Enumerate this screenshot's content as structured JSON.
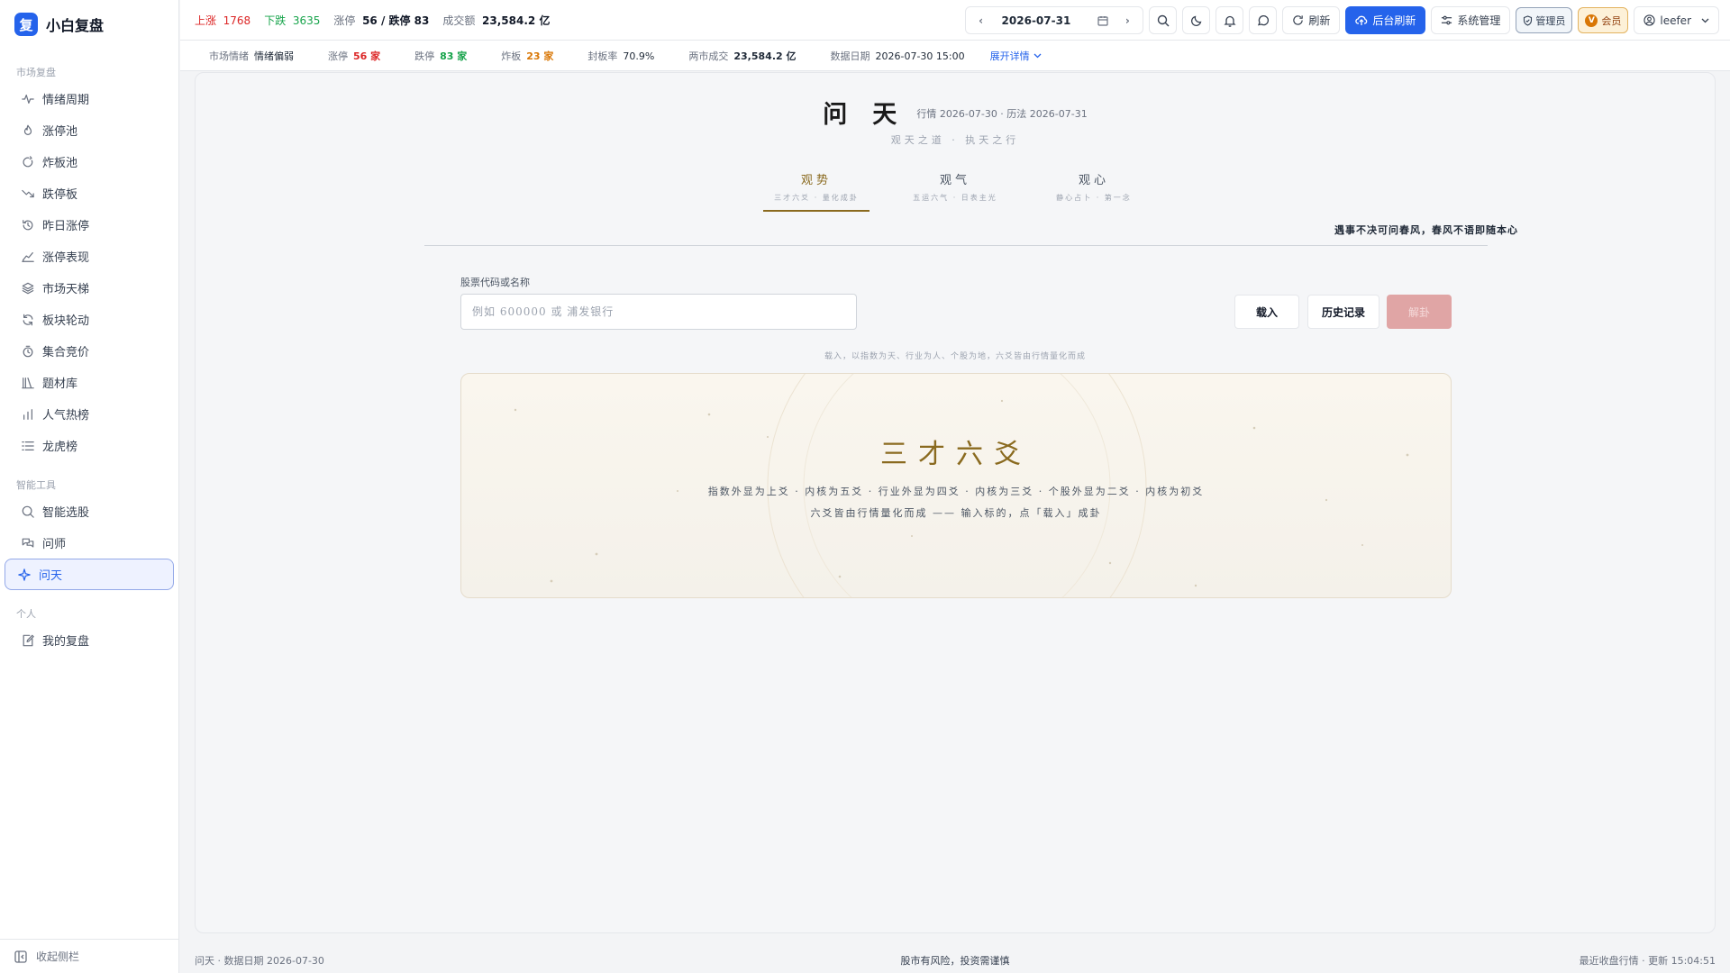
{
  "brand": {
    "logo": "复",
    "name": "小白复盘"
  },
  "sidebar": {
    "groups": [
      {
        "label": "市场复盘",
        "items": [
          {
            "label": "情绪周期",
            "icon": "activity-icon"
          },
          {
            "label": "涨停池",
            "icon": "flame-icon"
          },
          {
            "label": "炸板池",
            "icon": "burst-icon"
          },
          {
            "label": "跌停板",
            "icon": "trend-down-icon"
          },
          {
            "label": "昨日涨停",
            "icon": "history-icon"
          },
          {
            "label": "涨停表现",
            "icon": "area-chart-icon"
          },
          {
            "label": "市场天梯",
            "icon": "layers-icon"
          },
          {
            "label": "板块轮动",
            "icon": "rotate-icon"
          },
          {
            "label": "集合竞价",
            "icon": "timer-icon"
          },
          {
            "label": "题材库",
            "icon": "library-icon"
          },
          {
            "label": "人气热榜",
            "icon": "bar-chart-icon"
          },
          {
            "label": "龙虎榜",
            "icon": "list-icon"
          }
        ]
      },
      {
        "label": "智能工具",
        "items": [
          {
            "label": "智能选股",
            "icon": "search-icon"
          },
          {
            "label": "问师",
            "icon": "chat-icon"
          },
          {
            "label": "问天",
            "icon": "sparkle-icon",
            "active": true
          }
        ]
      },
      {
        "label": "个人",
        "items": [
          {
            "label": "我的复盘",
            "icon": "edit-icon"
          }
        ]
      }
    ],
    "collapse_label": "收起侧栏"
  },
  "topbar": {
    "up_label": "上涨",
    "up_value": "1768",
    "down_label": "下跌",
    "down_value": "3635",
    "limit_label": "涨停",
    "limit_value": "56 / 跌停 83",
    "volume_label": "成交额",
    "volume_value": "23,584.2 亿",
    "date": "2026-07-31",
    "refresh_label": "刷新",
    "bg_refresh_label": "后台刷新",
    "sys_label": "系统管理",
    "admin_label": "管理员",
    "vip_label": "会员",
    "vip_mark": "V",
    "user": "leefer"
  },
  "subbar": {
    "mood_label": "市场情绪",
    "mood_value": "情绪偏弱",
    "limit_up_label": "涨停",
    "limit_up_value": "56 家",
    "limit_down_label": "跌停",
    "limit_down_value": "83 家",
    "burst_label": "炸板",
    "burst_value": "23 家",
    "seal_label": "封板率",
    "seal_value": "70.9%",
    "turnover_label": "两市成交",
    "turnover_value": "23,584.2 亿",
    "date_label": "数据日期",
    "date_value": "2026-07-30 15:00",
    "expand_label": "展开详情"
  },
  "main": {
    "title": "问天",
    "title_sub": "行情 2026-07-30 · 历法 2026-07-31",
    "motto": "观天之道 · 执天之行",
    "tabs": [
      {
        "label": "观势",
        "sub": "三才六爻 · 量化成卦",
        "active": true
      },
      {
        "label": "观气",
        "sub": "五运六气 · 日表主光"
      },
      {
        "label": "观心",
        "sub": "静心占卜 · 第一念"
      }
    ],
    "quote": "遇事不决可问春风，春风不语即随本心",
    "field_label": "股票代码或名称",
    "input_placeholder": "例如 600000 或 浦发银行",
    "load_label": "载入",
    "history_label": "历史记录",
    "solve_label": "解卦",
    "hint": "载入，以指数为天、行业为人、个股为地，六爻皆由行情量化而成",
    "panel_title": "三才六爻",
    "panel_line1": "指数外显为上爻 · 内核为五爻 · 行业外显为四爻 · 内核为三爻 · 个股外显为二爻 · 内核为初爻",
    "panel_line2": "六爻皆由行情量化而成 —— 输入标的，点「载入」成卦"
  },
  "footer": {
    "left": "问天 · 数据日期 2026-07-30",
    "center": "股市有风险，投资需谨慎",
    "right": "最近收盘行情 · 更新 15:04:51"
  }
}
